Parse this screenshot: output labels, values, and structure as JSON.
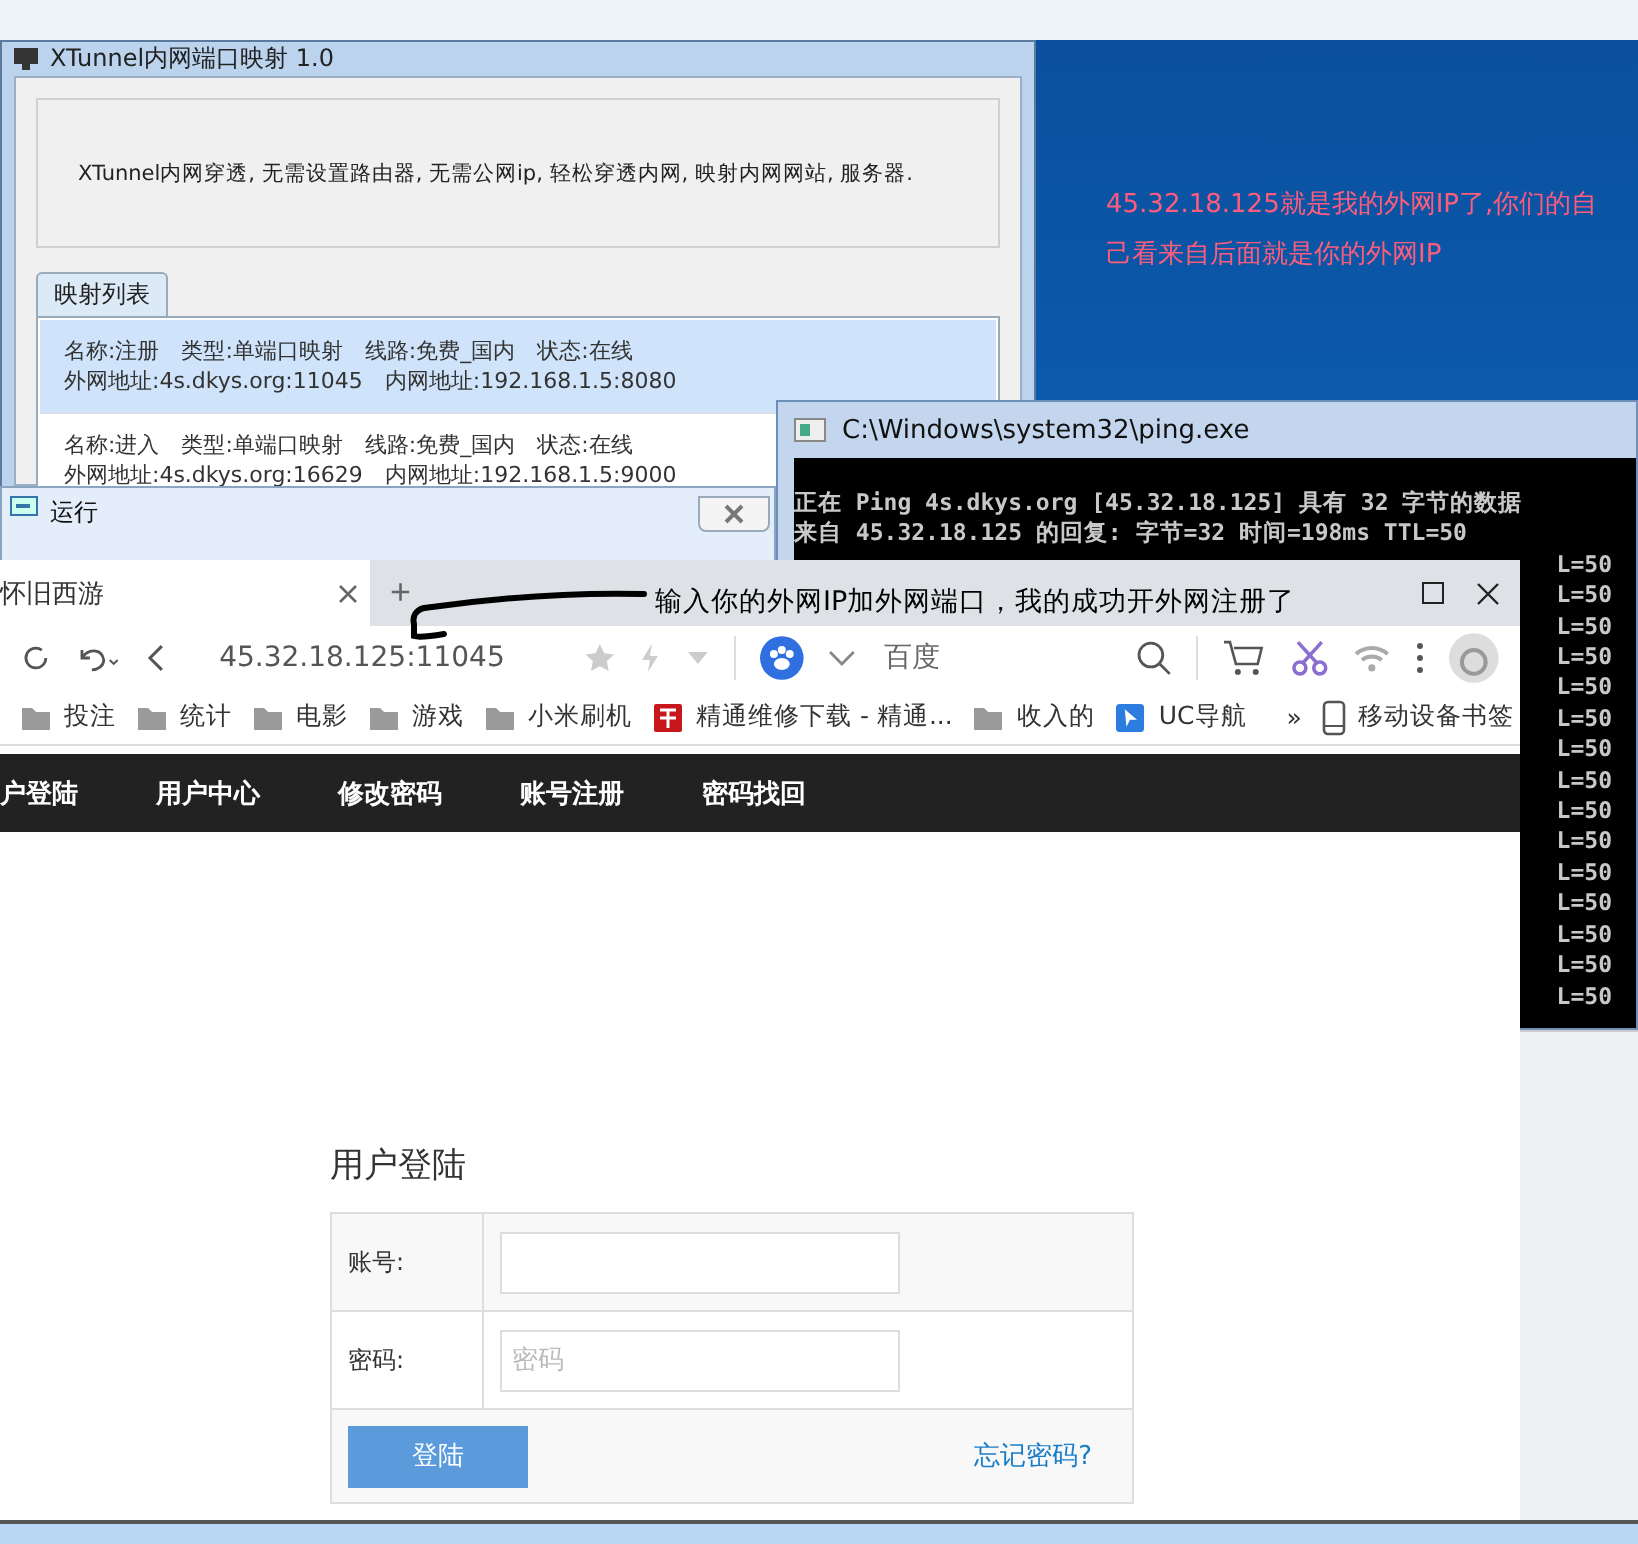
{
  "xtunnel": {
    "title": "XTunnel内网端口映射 1.0",
    "description": "XTunnel内网穿透, 无需设置路由器, 无需公网ip, 轻松穿透内网, 映射内网网站, 服务器.",
    "tab": {
      "label": "映射列表",
      "selected": true
    },
    "mappings": [
      {
        "line1": "名称:注册　类型:单端口映射　线路:免费_国内　状态:在线",
        "line2": "外网地址:4s.dkys.org:11045　内网地址:192.168.1.5:8080",
        "selected": true
      },
      {
        "line1": "名称:进入　类型:单端口映射　线路:免费_国内　状态:在线",
        "line2": "外网地址:4s.dkys.org:16629　内网地址:192.168.1.5:9000",
        "selected": false
      }
    ]
  },
  "desktop_note": [
    "45.32.18.125就是我的外网IP了,你们的自",
    "己看来自后面就是你的外网IP"
  ],
  "cmd": {
    "title": "C:\\Windows\\system32\\ping.exe",
    "lines": [
      "正在 Ping 4s.dkys.org [45.32.18.125] 具有 32 字节的数据",
      "来自 45.32.18.125 的回复: 字节=32 时间=198ms TTL=50"
    ],
    "tail_lines": [
      "L=50",
      "L=50",
      "L=50",
      "L=50",
      "L=50",
      "L=50",
      "L=50",
      "L=50",
      "L=50",
      "L=50",
      "L=50",
      "L=50",
      "L=50",
      "L=50",
      "L=50"
    ]
  },
  "run_dialog": {
    "title": "运行"
  },
  "browser": {
    "tab": {
      "title": "怀旧西游",
      "selected": true
    },
    "new_tab": "+",
    "annotation": "输入你的外网IP加外网端口，我的成功开外网注册了",
    "url": "45.32.18.125:11045",
    "search": {
      "placeholder": "百度"
    },
    "bookmarks": [
      {
        "label": "投注",
        "kind": "folder"
      },
      {
        "label": "统计",
        "kind": "folder"
      },
      {
        "label": "电影",
        "kind": "folder"
      },
      {
        "label": "游戏",
        "kind": "folder"
      },
      {
        "label": "小米刷机",
        "kind": "folder"
      },
      {
        "label": "精通维修下载 - 精通...",
        "kind": "site"
      },
      {
        "label": "收入的",
        "kind": "folder"
      },
      {
        "label": "UC导航",
        "kind": "nav"
      }
    ],
    "overflow": "»",
    "mobile_bookmarks": "移动设备书签",
    "nav": [
      "户登陆",
      "用户中心",
      "修改密码",
      "账号注册",
      "密码找回"
    ],
    "login": {
      "title": "用户登陆",
      "fields": [
        {
          "label": "账号:"
        },
        {
          "label": "密码:",
          "placeholder": "密码"
        }
      ],
      "submit": "登陆",
      "forgot": "忘记密码?"
    }
  }
}
